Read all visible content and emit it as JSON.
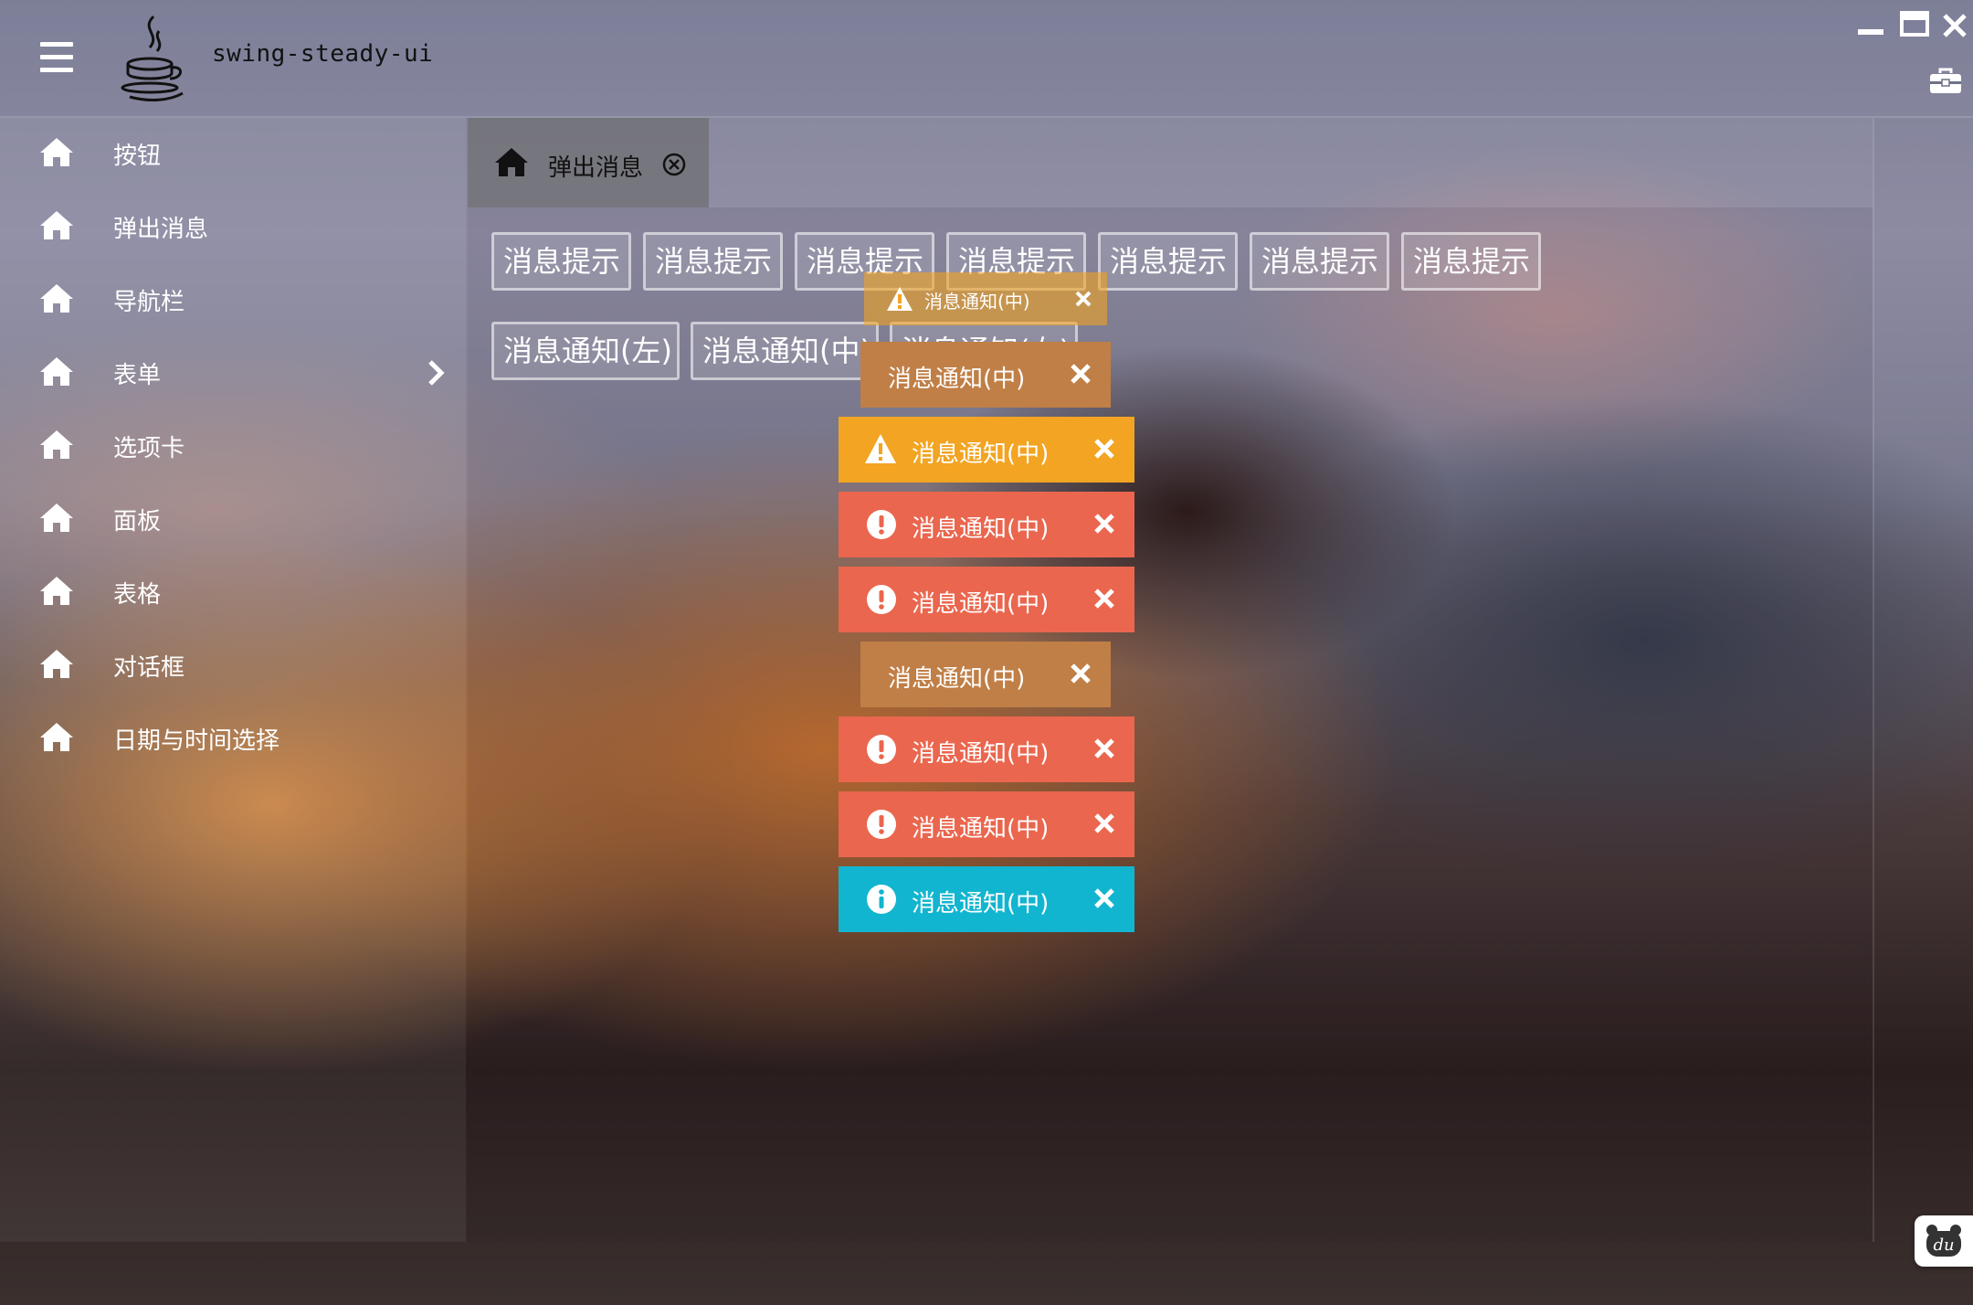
{
  "app": {
    "title": "swing-steady-ui"
  },
  "sidebar": {
    "items": [
      {
        "label": "按钮",
        "icon": "home-icon"
      },
      {
        "label": "弹出消息",
        "icon": "home-icon"
      },
      {
        "label": "导航栏",
        "icon": "home-icon"
      },
      {
        "label": "表单",
        "icon": "home-icon",
        "has_submenu": true
      },
      {
        "label": "选项卡",
        "icon": "home-icon"
      },
      {
        "label": "面板",
        "icon": "home-icon"
      },
      {
        "label": "表格",
        "icon": "home-icon"
      },
      {
        "label": "对话框",
        "icon": "home-icon"
      },
      {
        "label": "日期与时间选择",
        "icon": "home-icon"
      }
    ]
  },
  "tabs": [
    {
      "label": "弹出消息",
      "icon": "home-icon",
      "active": true
    }
  ],
  "buttons": {
    "row1": [
      "消息提示",
      "消息提示",
      "消息提示",
      "消息提示",
      "消息提示",
      "消息提示",
      "消息提示"
    ],
    "row2": [
      "消息通知(左)",
      "消息通知(中)",
      "消息通知(右)"
    ]
  },
  "toasts": [
    {
      "text": "消息通知(中)",
      "type": "warning",
      "icon": "warning-icon",
      "color": "#f2a422",
      "faded": true
    },
    {
      "text": "消息通知(中)",
      "type": "default",
      "icon": "",
      "color": "#c07f46"
    },
    {
      "text": "消息通知(中)",
      "type": "warning",
      "icon": "warning-icon",
      "color": "#f2a422"
    },
    {
      "text": "消息通知(中)",
      "type": "error",
      "icon": "exclamation-circle-icon",
      "color": "#ea664e"
    },
    {
      "text": "消息通知(中)",
      "type": "error",
      "icon": "exclamation-circle-icon",
      "color": "#ea664e"
    },
    {
      "text": "消息通知(中)",
      "type": "default",
      "icon": "",
      "color": "#c07f46"
    },
    {
      "text": "消息通知(中)",
      "type": "error",
      "icon": "exclamation-circle-icon",
      "color": "#ea664e"
    },
    {
      "text": "消息通知(中)",
      "type": "error",
      "icon": "exclamation-circle-icon",
      "color": "#ea664e"
    },
    {
      "text": "消息通知(中)",
      "type": "info",
      "icon": "info-circle-icon",
      "color": "#12b5cf"
    }
  ]
}
